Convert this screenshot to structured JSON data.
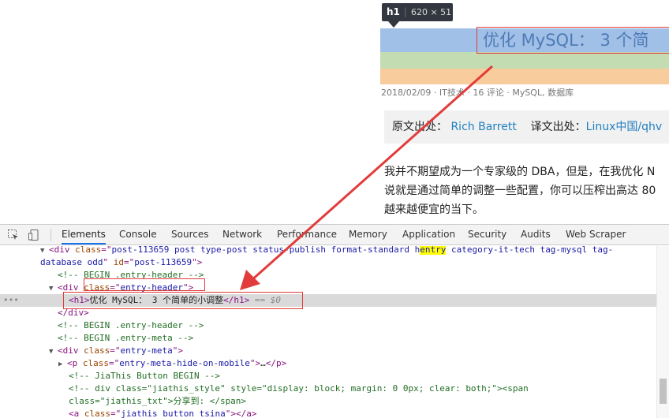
{
  "preview": {
    "tooltip_tag": "h1",
    "tooltip_dims": "620 × 51",
    "title": "优化 MySQL： 3 个简",
    "meta": "2018/02/09 · IT技术 · 16 评论 · MySQL, 数据库",
    "source_label": "原文出处：",
    "source_author": "Rich Barrett",
    "translation_label": "译文出处：",
    "translation_site": "Linux中国/qhv",
    "para_lines": [
      "我并不期望成为一个专家级的 DBA，但是，在我优化 N",
      "说就是通过简单的调整一些配置，你可以压榨出高达 80",
      "越来越便宜的当下。"
    ]
  },
  "devtools": {
    "tabs": [
      {
        "label": "Elements",
        "active": true
      },
      {
        "label": "Console"
      },
      {
        "label": "Sources"
      },
      {
        "label": "Network"
      },
      {
        "label": "Performance"
      },
      {
        "label": "Memory"
      },
      {
        "label": "Application"
      },
      {
        "label": "Security"
      },
      {
        "label": "Audits"
      },
      {
        "label": "Web Scraper"
      }
    ],
    "dom": {
      "l1_tag": "div",
      "l1_attr": "class",
      "l1_val_a": "post-113659 post type-post status-publish format-standard h",
      "l1_val_hl": "entry",
      "l1_val_b": " category-it-tech tag-mysql tag-",
      "l2_val": "database odd",
      "l2_attr": "id",
      "l2_id": "post-113659",
      "c1": "<!-- BEGIN .entry-header -->",
      "div_tag": "div",
      "div_attr": "class",
      "div_val": "entry-header",
      "h1_tag": "h1",
      "h1_text": "优化 MySQL： 3 个简单的小调整",
      "eq": "== $0",
      "close_div": "div",
      "c2": "<!-- BEGIN .entry-header -->",
      "c3": "<!-- BEGIN .entry-meta -->",
      "meta_tag": "div",
      "meta_attr": "class",
      "meta_val": "entry-meta",
      "p_tag": "p",
      "p_attr": "class",
      "p_val": "entry-meta-hide-on-mobile",
      "p_ellipsis": "…",
      "c4": "<!-- JiaThis Button BEGIN -->",
      "c5a": "<!-- div class=\"jiathis_style\" style=\"display: block; margin: 0 0px; clear: both;\"><span",
      "c5b": "class=\"jiathis_txt\">分享到: </span>",
      "a_tag": "a",
      "a_attr": "class",
      "a_val": "jiathis_button_tsina"
    }
  },
  "colors": {
    "highlight_blue": "#a0c0e8",
    "highlight_green": "#c3dcb2",
    "highlight_orange": "#f9cc9d",
    "annotation_red": "#e23b3b",
    "active_tab": "#1a73e8"
  }
}
